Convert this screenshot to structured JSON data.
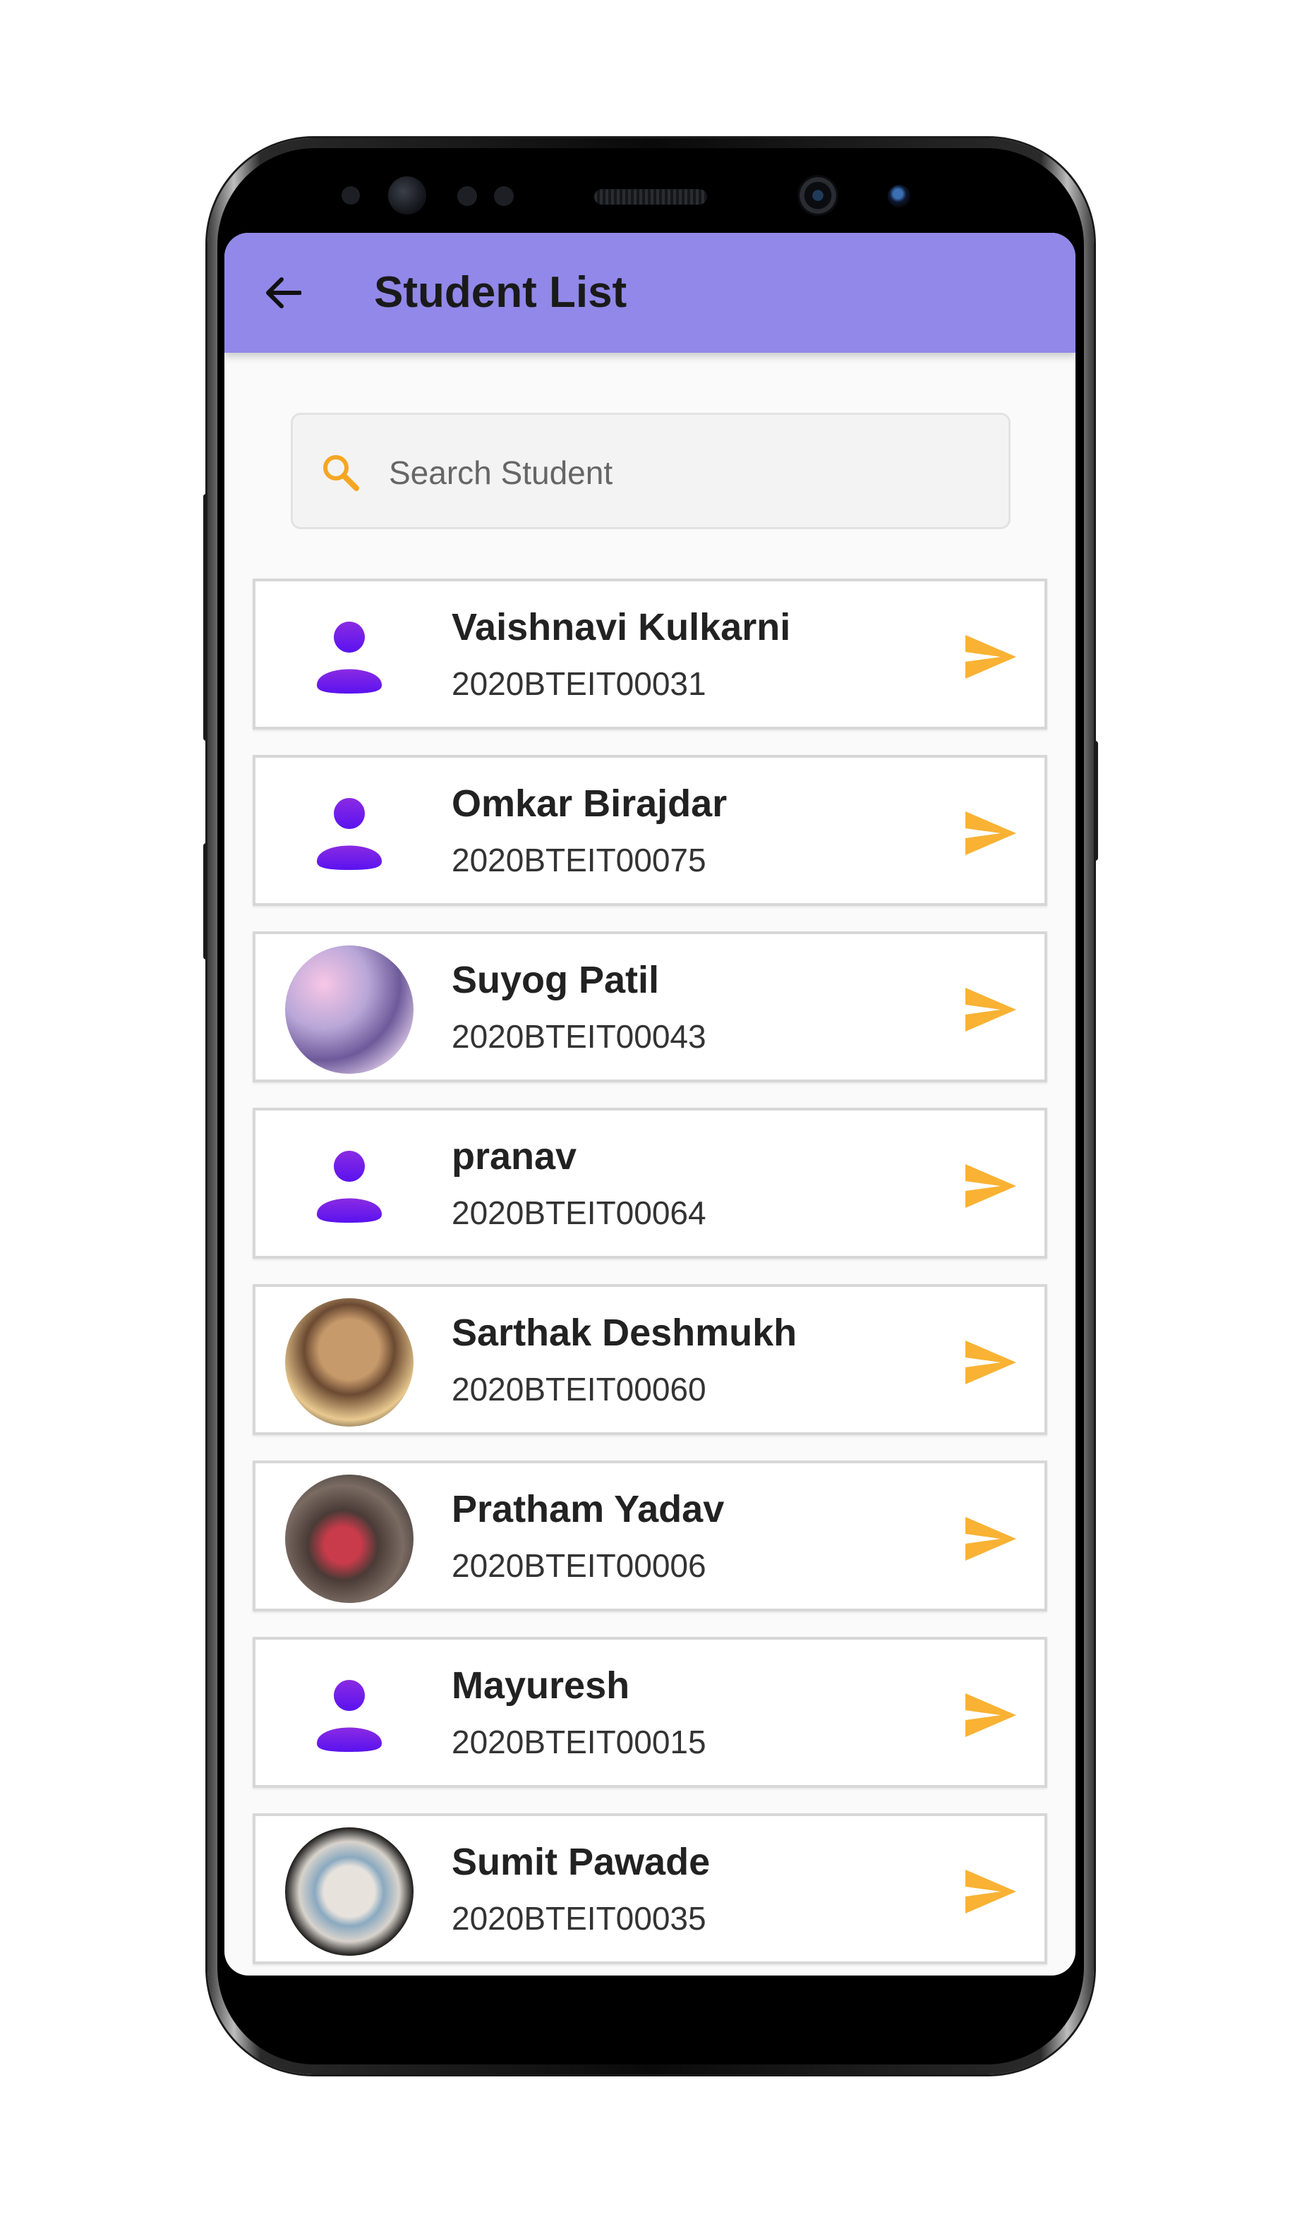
{
  "app": {
    "title": "Student List"
  },
  "search": {
    "placeholder": "Search Student",
    "value": ""
  },
  "students": [
    {
      "name": "Vaishnavi Kulkarni",
      "id": "2020BTEIT00031",
      "avatar": "default-person-icon"
    },
    {
      "name": "Omkar Birajdar",
      "id": "2020BTEIT00075",
      "avatar": "default-person-icon"
    },
    {
      "name": "Suyog Patil",
      "id": "2020BTEIT00043",
      "avatar": "photo"
    },
    {
      "name": "pranav",
      "id": "2020BTEIT00064",
      "avatar": "default-person-icon"
    },
    {
      "name": "Sarthak Deshmukh",
      "id": "2020BTEIT00060",
      "avatar": "photo"
    },
    {
      "name": "Pratham Yadav",
      "id": "2020BTEIT00006",
      "avatar": "photo"
    },
    {
      "name": "Mayuresh",
      "id": "2020BTEIT00015",
      "avatar": "default-person-icon"
    },
    {
      "name": "Sumit Pawade",
      "id": "2020BTEIT00035",
      "avatar": "photo"
    }
  ],
  "colors": {
    "appbar": "#9188e9",
    "accent": "#f9b233",
    "avatar_icon": "#7a22e6"
  },
  "icons": {
    "back": "arrow-left-icon",
    "search": "search-icon",
    "send": "send-icon",
    "person": "person-icon"
  }
}
